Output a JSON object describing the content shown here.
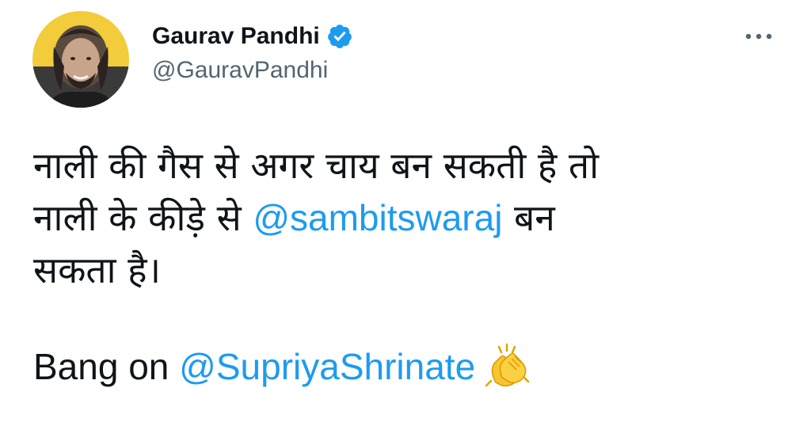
{
  "author": {
    "display_name": "Gaurav Pandhi",
    "handle": "@GauravPandhi",
    "verified": true
  },
  "icons": {
    "verified": "verified-badge-icon",
    "more": "more-horizontal-icon",
    "emoji": "clapping-hands-icon"
  },
  "colors": {
    "mention": "#1d9bf0",
    "verified": "#1d9bf0",
    "secondary_text": "#536471"
  },
  "tweet": {
    "line1": "नाली की गैस से अगर चाय बन सकती है तो",
    "line2_prefix": "नाली के कीड़े से ",
    "line2_mention": "@sambitswaraj",
    "line2_suffix": " बन",
    "line3": "सकता है।",
    "line4_prefix": "Bang on ",
    "line4_mention": "@SupriyaShrinate"
  }
}
